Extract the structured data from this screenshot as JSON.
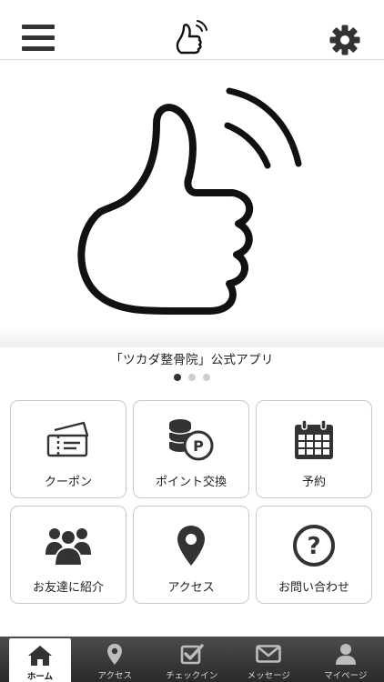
{
  "header": {
    "menu_icon": "hamburger-menu-icon",
    "logo_icon": "thumbs-up-logo-icon",
    "settings_icon": "gear-icon"
  },
  "banner": {
    "image_icon": "thumbs-up-wave-icon",
    "caption": "「ツカダ整骨院」公式アプリ",
    "slide_count": 3,
    "active_slide": 1
  },
  "menu": {
    "tiles": [
      {
        "label": "クーポン",
        "icon": "ticket-icon"
      },
      {
        "label": "ポイント交換",
        "icon": "coins-points-icon"
      },
      {
        "label": "予約",
        "icon": "calendar-icon"
      },
      {
        "label": "お友達に紹介",
        "icon": "group-people-icon"
      },
      {
        "label": "アクセス",
        "icon": "map-pin-icon"
      },
      {
        "label": "お問い合わせ",
        "icon": "question-circle-icon"
      }
    ]
  },
  "tabbar": {
    "tabs": [
      {
        "label": "ホーム",
        "icon": "home-icon",
        "active": true
      },
      {
        "label": "アクセス",
        "icon": "map-pin-icon",
        "active": false
      },
      {
        "label": "チェックイン",
        "icon": "checkbox-icon",
        "active": false
      },
      {
        "label": "メッセージ",
        "icon": "envelope-icon",
        "active": false
      },
      {
        "label": "マイページ",
        "icon": "user-icon",
        "active": false
      }
    ]
  },
  "colors": {
    "icon_dark": "#333333",
    "tabbar_top": "#4c4c4c",
    "tabbar_bottom": "#2a2a2a",
    "tile_border": "#c9c9c9",
    "dot_active": "#333333",
    "dot_inactive": "#cfcfcf"
  }
}
